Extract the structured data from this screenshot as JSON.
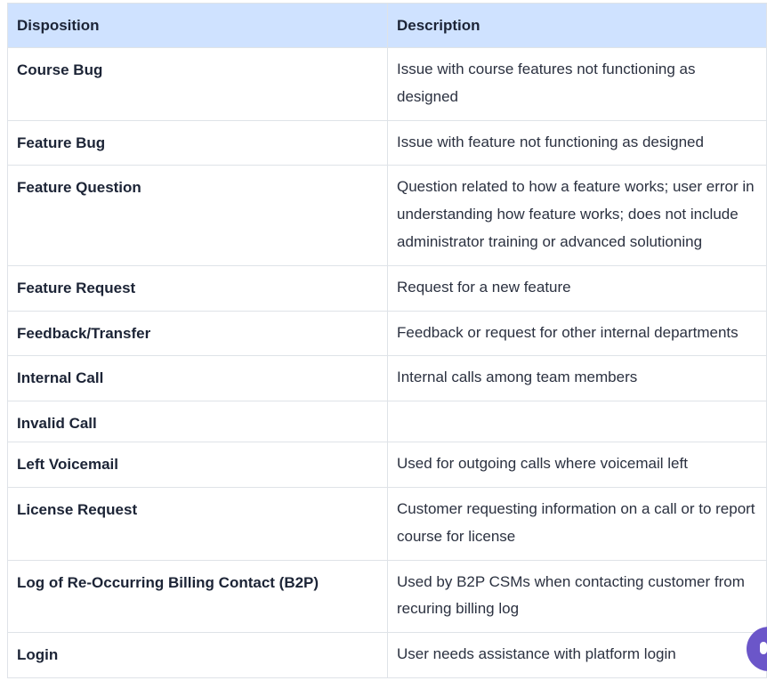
{
  "table": {
    "headers": {
      "disposition": "Disposition",
      "description": "Description"
    },
    "rows": [
      {
        "disposition": "Course Bug",
        "description": "Issue with course features not functioning as designed"
      },
      {
        "disposition": "Feature Bug",
        "description": "Issue with feature not functioning as designed"
      },
      {
        "disposition": "Feature Question",
        "description": "Question related to how a feature works; user error in understanding how feature works; does not include administrator training or advanced solutioning"
      },
      {
        "disposition": "Feature Request",
        "description": "Request for a new feature"
      },
      {
        "disposition": "Feedback/Transfer",
        "description": "Feedback or request for other internal departments"
      },
      {
        "disposition": "Internal Call",
        "description": "Internal calls among team members"
      },
      {
        "disposition": "Invalid Call",
        "description": ""
      },
      {
        "disposition": "Left Voicemail",
        "description": "Used for outgoing calls where voicemail left"
      },
      {
        "disposition": "License Request",
        "description": "Customer requesting information on a call or to report course for license"
      },
      {
        "disposition": "Log of Re-Occurring Billing Contact (B2P)",
        "description": "Used by B2P CSMs when contacting customer from recuring billing log"
      },
      {
        "disposition": "Login",
        "description": "User needs assistance with platform login"
      }
    ]
  },
  "chat_widget": {
    "icon": "chat-icon",
    "color": "#6b56c9"
  }
}
